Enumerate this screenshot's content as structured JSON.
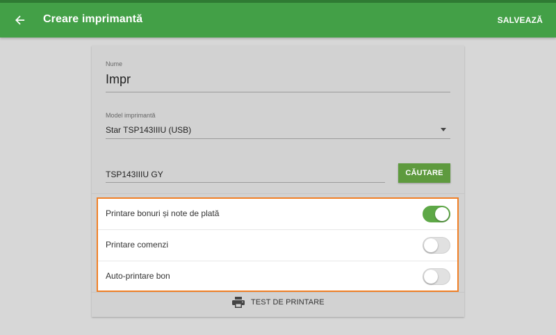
{
  "appbar": {
    "title": "Creare imprimantă",
    "save_label": "SALVEAZĂ",
    "back_icon": "arrow-left-icon",
    "color": "#43a047"
  },
  "form": {
    "name": {
      "label": "Nume",
      "value": "Impr"
    },
    "model": {
      "label": "Model imprimantă",
      "value": "Star TSP143IIIU (USB)"
    },
    "search": {
      "value": "TSP143IIIU GY",
      "button_label": "CĂUTARE"
    }
  },
  "toggles": [
    {
      "label": "Printare bonuri și note de plată",
      "checked": true
    },
    {
      "label": "Printare comenzi",
      "checked": false
    },
    {
      "label": "Auto-printare bon",
      "checked": false
    }
  ],
  "test_print": {
    "label": "TEST DE PRINTARE",
    "icon": "printer-icon"
  },
  "colors": {
    "accent": "#43a047",
    "button": "#5e9a3e",
    "highlight_border": "#f07f25"
  }
}
